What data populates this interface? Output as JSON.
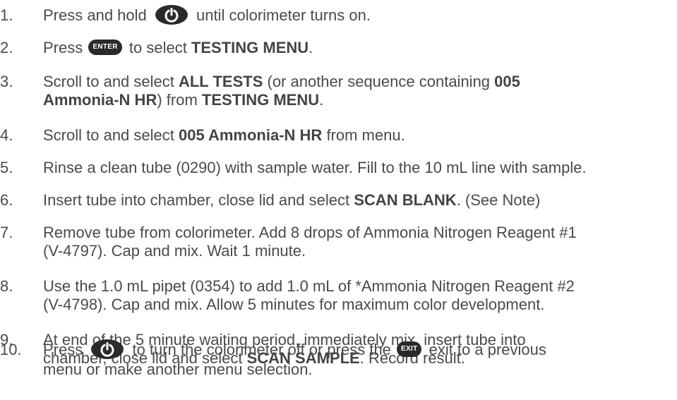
{
  "steps": [
    {
      "num": "1.",
      "parts": [
        {
          "t": "Press and hold "
        },
        {
          "icon": "power"
        },
        {
          "t": " until colorimeter turns on."
        }
      ]
    },
    {
      "num": "2.",
      "parts": [
        {
          "t": "Press "
        },
        {
          "icon": "enter",
          "label": "ENTER"
        },
        {
          "t": " to select "
        },
        {
          "b": "TESTING MENU"
        },
        {
          "t": "."
        }
      ]
    },
    {
      "num": "3.",
      "parts": [
        {
          "t": "Scroll to and select "
        },
        {
          "b": "ALL TESTS"
        },
        {
          "t": " (or another sequence containing "
        },
        {
          "b": "005"
        },
        {
          "br": true
        },
        {
          "b": "Ammonia-N HR"
        },
        {
          "t": ") from "
        },
        {
          "b": "TESTING MENU"
        },
        {
          "t": "."
        }
      ]
    },
    {
      "num": "4.",
      "parts": [
        {
          "t": "Scroll to and select "
        },
        {
          "b": "005 Ammonia-N HR"
        },
        {
          "t": " from menu."
        }
      ]
    },
    {
      "num": "5.",
      "parts": [
        {
          "t": "Rinse a clean tube (0290) with sample water. Fill to the 10 mL line with sample."
        }
      ]
    },
    {
      "num": "6.",
      "parts": [
        {
          "t": "Insert tube into chamber, close lid and select "
        },
        {
          "b": "SCAN BLANK"
        },
        {
          "t": ". (See Note)"
        }
      ]
    },
    {
      "num": "7.",
      "parts": [
        {
          "t": "Remove tube from colorimeter. Add 8 drops of Ammonia Nitrogen Reagent #1"
        },
        {
          "br": true
        },
        {
          "t": "(V-4797). Cap and mix. Wait 1 minute."
        }
      ]
    },
    {
      "num": "8.",
      "parts": [
        {
          "t": "Use the 1.0 mL pipet (0354) to add 1.0 mL of *Ammonia Nitrogen Reagent #2"
        },
        {
          "br": true
        },
        {
          "t": "(V-4798). Cap and mix. Allow 5 minutes for maximum color development."
        }
      ]
    },
    {
      "num": "9.",
      "parts": [
        {
          "t": "At end of the 5 minute waiting period, immediately mix, insert tube into"
        },
        {
          "br": true
        },
        {
          "t": "chamber, close lid and select "
        },
        {
          "b": "SCAN SAMPLE"
        },
        {
          "t": ". Record result."
        }
      ]
    },
    {
      "num": "10.",
      "parts": [
        {
          "t": "Press "
        },
        {
          "icon": "power"
        },
        {
          "t": " to turn the colorimeter off or press the "
        },
        {
          "icon": "exit",
          "label": "EXIT"
        },
        {
          "t": " exit to a previous"
        },
        {
          "br": true
        },
        {
          "t": "menu or make another menu selection."
        }
      ]
    }
  ]
}
